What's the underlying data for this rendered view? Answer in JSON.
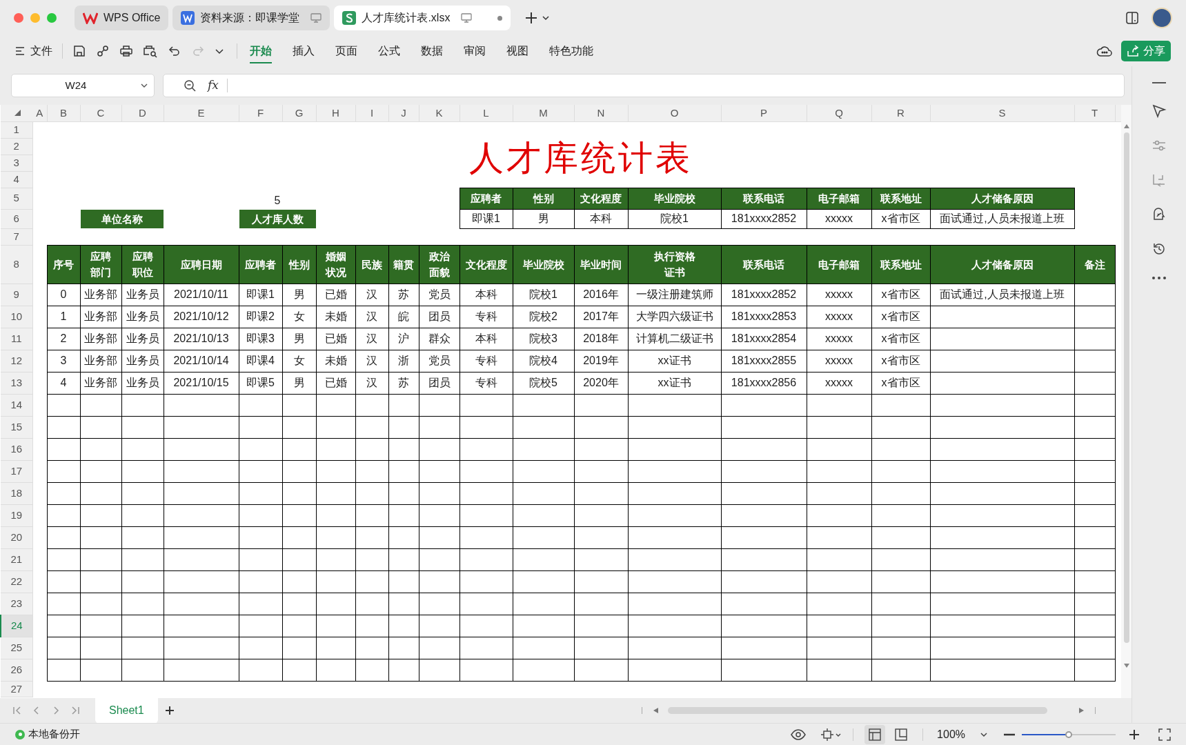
{
  "window": {
    "tabs": [
      {
        "label": "WPS Office",
        "kind": "wps",
        "selected": false
      },
      {
        "label": "资料来源：即课学堂",
        "kind": "writer",
        "selected": false
      },
      {
        "label": "人才库统计表.xlsx",
        "kind": "sheet",
        "selected": true
      }
    ]
  },
  "toolbar": {
    "file_menu": "文件",
    "ribbon_tabs": [
      {
        "label": "开始",
        "selected": true
      },
      {
        "label": "插入",
        "selected": false
      },
      {
        "label": "页面",
        "selected": false
      },
      {
        "label": "公式",
        "selected": false
      },
      {
        "label": "数据",
        "selected": false
      },
      {
        "label": "审阅",
        "selected": false
      },
      {
        "label": "视图",
        "selected": false
      },
      {
        "label": "特色功能",
        "selected": false
      }
    ],
    "share_button": "分享"
  },
  "formula_bar": {
    "cell_reference": "W24",
    "function_label": "fx"
  },
  "sheet": {
    "columns": [
      "A",
      "B",
      "C",
      "D",
      "E",
      "F",
      "G",
      "H",
      "I",
      "J",
      "K",
      "L",
      "M",
      "N",
      "O",
      "P",
      "Q",
      "R",
      "S",
      "T"
    ],
    "rows": [
      {
        "number": "1",
        "selected": false
      },
      {
        "number": "2",
        "selected": false
      },
      {
        "number": "3",
        "selected": false
      },
      {
        "number": "4",
        "selected": false
      },
      {
        "number": "5",
        "selected": false
      },
      {
        "number": "6",
        "selected": false
      },
      {
        "number": "7",
        "selected": false
      },
      {
        "number": "8",
        "selected": false
      },
      {
        "number": "9",
        "selected": false
      },
      {
        "number": "10",
        "selected": false
      },
      {
        "number": "11",
        "selected": false
      },
      {
        "number": "12",
        "selected": false
      },
      {
        "number": "13",
        "selected": false
      },
      {
        "number": "14",
        "selected": false
      },
      {
        "number": "15",
        "selected": false
      },
      {
        "number": "16",
        "selected": false
      },
      {
        "number": "17",
        "selected": false
      },
      {
        "number": "18",
        "selected": false
      },
      {
        "number": "19",
        "selected": false
      },
      {
        "number": "20",
        "selected": false
      },
      {
        "number": "21",
        "selected": false
      },
      {
        "number": "22",
        "selected": false
      },
      {
        "number": "23",
        "selected": false
      },
      {
        "number": "24",
        "selected": true
      },
      {
        "number": "25",
        "selected": false
      },
      {
        "number": "26",
        "selected": false
      },
      {
        "number": "27",
        "selected": false
      }
    ],
    "title": "人才库统计表",
    "headcount": "5",
    "labels": [
      "单位名称",
      "人才库人数"
    ],
    "summary_table": {
      "columns": [
        "应聘者",
        "性别",
        "文化程度",
        "毕业院校",
        "联系电话",
        "电子邮箱",
        "联系地址",
        "人才储备原因"
      ],
      "row": [
        "即课1",
        "男",
        "本科",
        "院校1",
        "181xxxx2852",
        "xxxxx",
        "x省市区",
        "面试通过,人员未报道上班"
      ]
    },
    "main_table": {
      "columns": [
        "序号",
        "应聘部门",
        "应聘职位",
        "应聘日期",
        "应聘者",
        "性别",
        "婚姻状况",
        "民族",
        "籍贯",
        "政治面貌",
        "文化程度",
        "毕业院校",
        "毕业时间",
        "执行资格证书",
        "联系电话",
        "电子邮箱",
        "联系地址",
        "人才储备原因",
        "备注"
      ],
      "rows": [
        [
          "0",
          "业务部",
          "业务员",
          "2021/10/11",
          "即课1",
          "男",
          "已婚",
          "汉",
          "苏",
          "党员",
          "本科",
          "院校1",
          "2016年",
          "一级注册建筑师",
          "181xxxx2852",
          "xxxxx",
          "x省市区",
          "面试通过,人员未报道上班",
          null
        ],
        [
          "1",
          "业务部",
          "业务员",
          "2021/10/12",
          "即课2",
          "女",
          "未婚",
          "汉",
          "皖",
          "团员",
          "专科",
          "院校2",
          "2017年",
          "大学四六级证书",
          "181xxxx2853",
          "xxxxx",
          "x省市区",
          null,
          null
        ],
        [
          "2",
          "业务部",
          "业务员",
          "2021/10/13",
          "即课3",
          "男",
          "已婚",
          "汉",
          "沪",
          "群众",
          "本科",
          "院校3",
          "2018年",
          "计算机二级证书",
          "181xxxx2854",
          "xxxxx",
          "x省市区",
          null,
          null
        ],
        [
          "3",
          "业务部",
          "业务员",
          "2021/10/14",
          "即课4",
          "女",
          "未婚",
          "汉",
          "浙",
          "党员",
          "专科",
          "院校4",
          "2019年",
          "xx证书",
          "181xxxx2855",
          "xxxxx",
          "x省市区",
          null,
          null
        ],
        [
          "4",
          "业务部",
          "业务员",
          "2021/10/15",
          "即课5",
          "男",
          "已婚",
          "汉",
          "苏",
          "团员",
          "专科",
          "院校5",
          "2020年",
          "xx证书",
          "181xxxx2856",
          "xxxxx",
          "x省市区",
          null,
          null
        ]
      ]
    }
  },
  "sheet_tabs": [
    {
      "label": "Sheet1",
      "selected": true
    }
  ],
  "status_bar": {
    "backup": "本地备份开",
    "zoom": "100%",
    "zoom_slider": {
      "level": 0.5
    }
  }
}
